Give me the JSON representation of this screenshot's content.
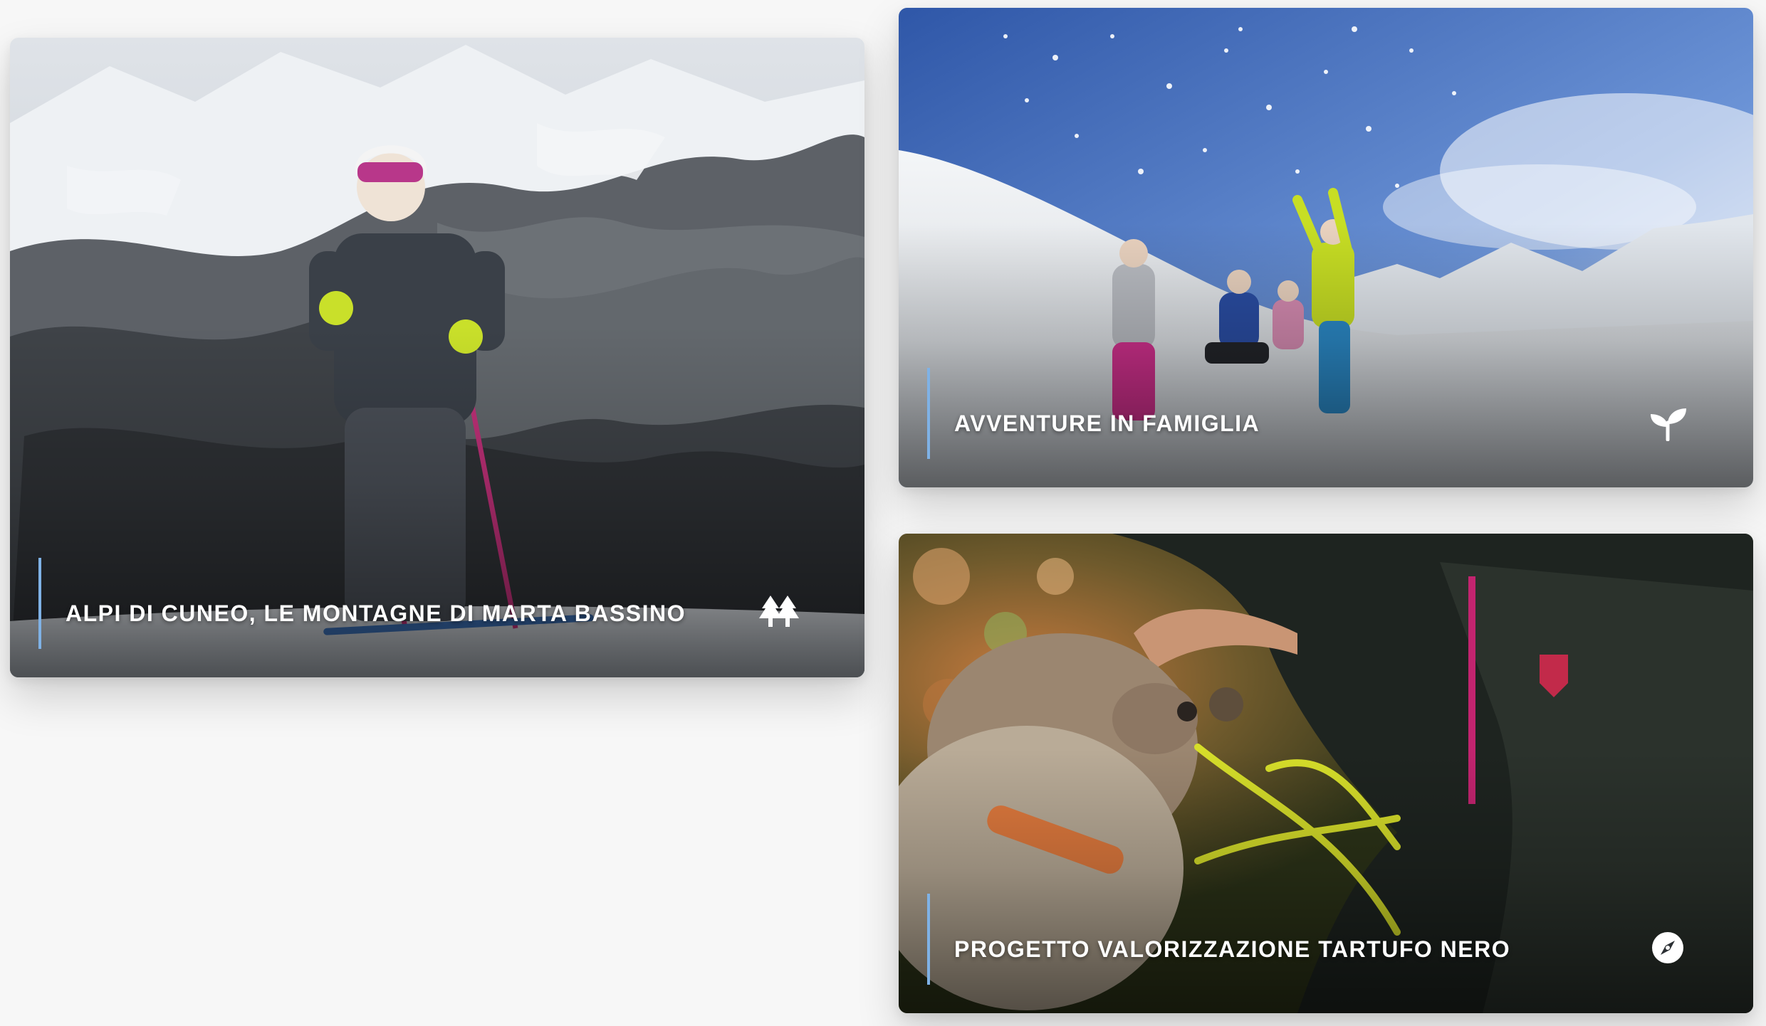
{
  "cards": [
    {
      "title": "ALPI DI CUNEO, LE MONTAGNE DI MARTA BASSINO",
      "icon": "trees-icon",
      "image": "skier-on-snowy-mountain-photo"
    },
    {
      "title": "AVVENTURE IN FAMIGLIA",
      "icon": "sprout-icon",
      "image": "family-playing-in-snow-photo"
    },
    {
      "title": "PROGETTO VALORIZZAZIONE TARTUFO NERO",
      "icon": "compass-icon",
      "image": "truffle-dog-photo"
    }
  ],
  "colors": {
    "background": "#f7f7f7",
    "accent_line": "#7fb2e6",
    "caption_text": "#ffffff"
  }
}
